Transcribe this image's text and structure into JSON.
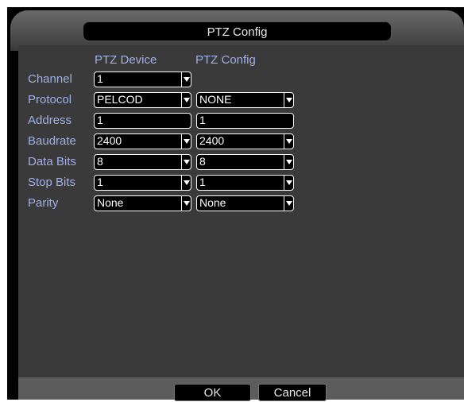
{
  "dialog": {
    "title": "PTZ Config"
  },
  "columns": {
    "device": "PTZ Device",
    "config": "PTZ Config"
  },
  "rows": {
    "channel": {
      "label": "Channel",
      "device": "1"
    },
    "protocol": {
      "label": "Protocol",
      "device": "PELCOD",
      "config": "NONE"
    },
    "address": {
      "label": "Address",
      "device": "1",
      "config": "1"
    },
    "baudrate": {
      "label": "Baudrate",
      "device": "2400",
      "config": "2400"
    },
    "databits": {
      "label": "Data Bits",
      "device": "8",
      "config": "8"
    },
    "stopbits": {
      "label": "Stop Bits",
      "device": "1",
      "config": "1"
    },
    "parity": {
      "label": "Parity",
      "device": "None",
      "config": "None"
    }
  },
  "buttons": {
    "ok": "OK",
    "cancel": "Cancel"
  },
  "colors": {
    "label_text": "#9fb0e6",
    "panel_bg": "#3a3a3a",
    "field_bg": "#000000"
  }
}
